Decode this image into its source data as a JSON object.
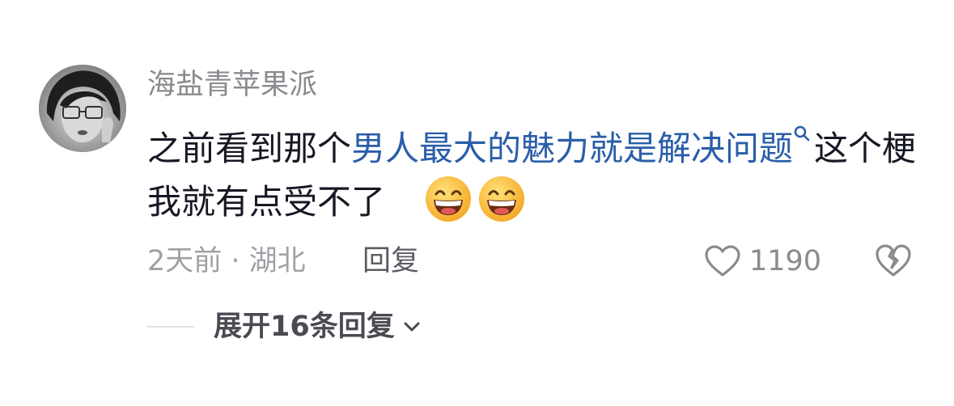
{
  "comment": {
    "username": "海盐青苹果派",
    "text_before": "之前看到那个",
    "topic_link": "男人最大的魅力就是解决问题",
    "text_after": "这个梗我就有点受不了",
    "emojis": [
      "grinning-face-emoji",
      "grinning-face-emoji"
    ],
    "meta": "2天前 · 湖北",
    "reply_label": "回复",
    "like_count": "1190",
    "expand_replies_label": "展开16条回复"
  },
  "colors": {
    "username": "#8a8a8f",
    "text": "#161823",
    "link": "#2a5ea8",
    "meta": "#a0a0a6"
  },
  "icons": {
    "search": "search-icon",
    "like": "heart-outline-icon",
    "dislike": "broken-heart-icon",
    "expand": "chevron-down-icon"
  }
}
